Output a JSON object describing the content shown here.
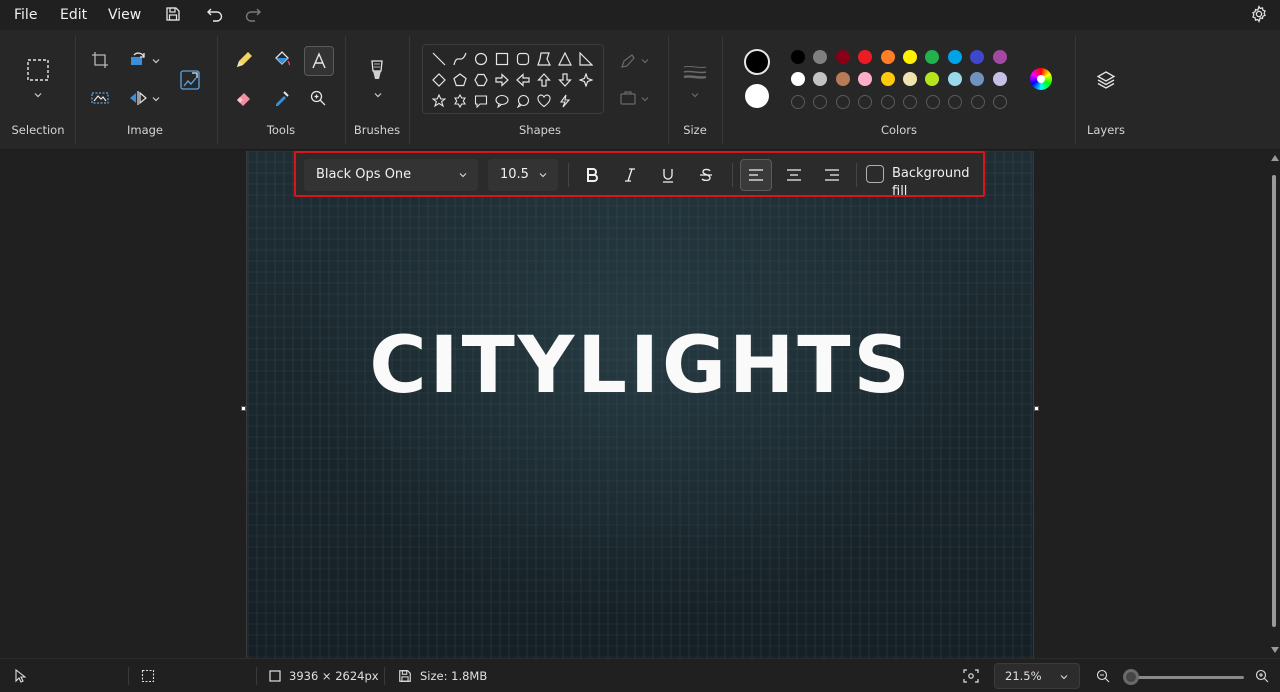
{
  "menu": {
    "file": "File",
    "edit": "Edit",
    "view": "View"
  },
  "ribbon": {
    "groups": {
      "selection": "Selection",
      "image": "Image",
      "tools": "Tools",
      "brushes": "Brushes",
      "shapes": "Shapes",
      "size": "Size",
      "colors": "Colors",
      "layers": "Layers"
    },
    "primary_color": "#000000",
    "secondary_color": "#ffffff",
    "palette_row1": [
      "#000000",
      "#7f7f7f",
      "#880015",
      "#ed1c24",
      "#ff7f27",
      "#fff200",
      "#22b14c",
      "#00a2e8",
      "#3f48cc",
      "#a349a4"
    ],
    "palette_row2": [
      "#ffffff",
      "#c3c3c3",
      "#b97a57",
      "#ffaec9",
      "#ffc90e",
      "#efe4b0",
      "#b5e61d",
      "#99d9ea",
      "#7092be",
      "#c8bfe7"
    ]
  },
  "text_toolbar": {
    "font": "Black Ops One",
    "size": "10.5",
    "background_fill": "Background fill"
  },
  "canvas": {
    "text": "CITYLIGHTS"
  },
  "status": {
    "dimensions": "3936 × 2624px",
    "size": "Size: 1.8MB",
    "zoom": "21.5%"
  },
  "accent_color": "#d9141a"
}
